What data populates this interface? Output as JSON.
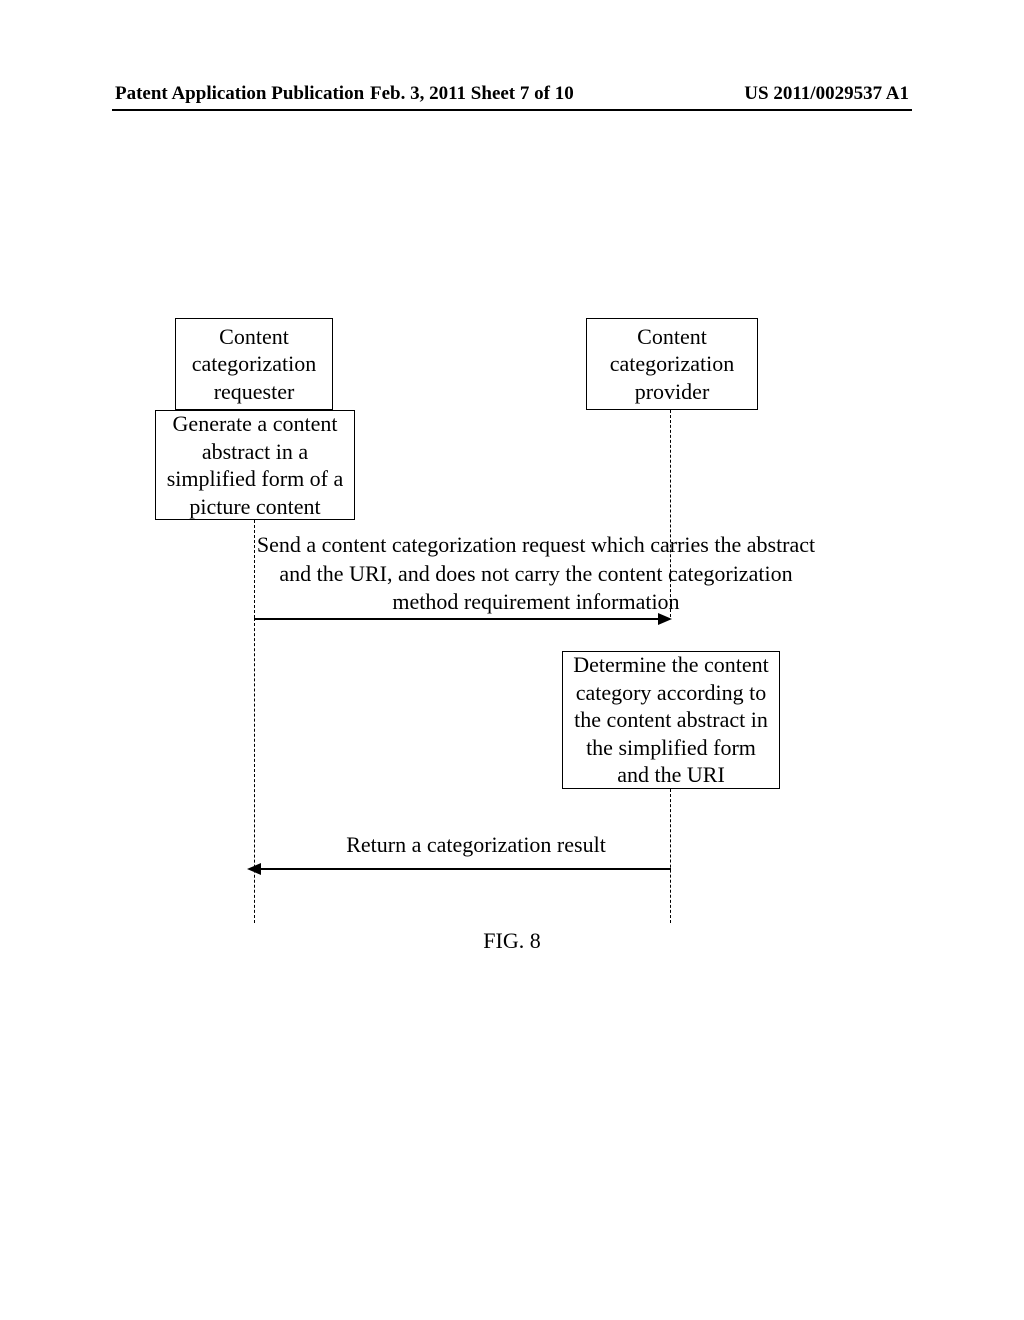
{
  "header": {
    "left": "Patent Application Publication",
    "center": "Feb. 3, 2011   Sheet 7 of 10",
    "right": "US 2011/0029537 A1"
  },
  "entities": {
    "requester": "Content categorization requester",
    "provider": "Content categorization provider"
  },
  "steps": {
    "generate_abstract": "Generate a content abstract in a simplified form of a picture content",
    "determine_category": "Determine the content category according to the content abstract  in the simplified form and the URI"
  },
  "messages": {
    "send_request": "Send a content categorization request which carries the abstract and the URI, and does not carry the content categorization method requirement information",
    "return_result": "Return a categorization result"
  },
  "figure_label": "FIG. 8"
}
